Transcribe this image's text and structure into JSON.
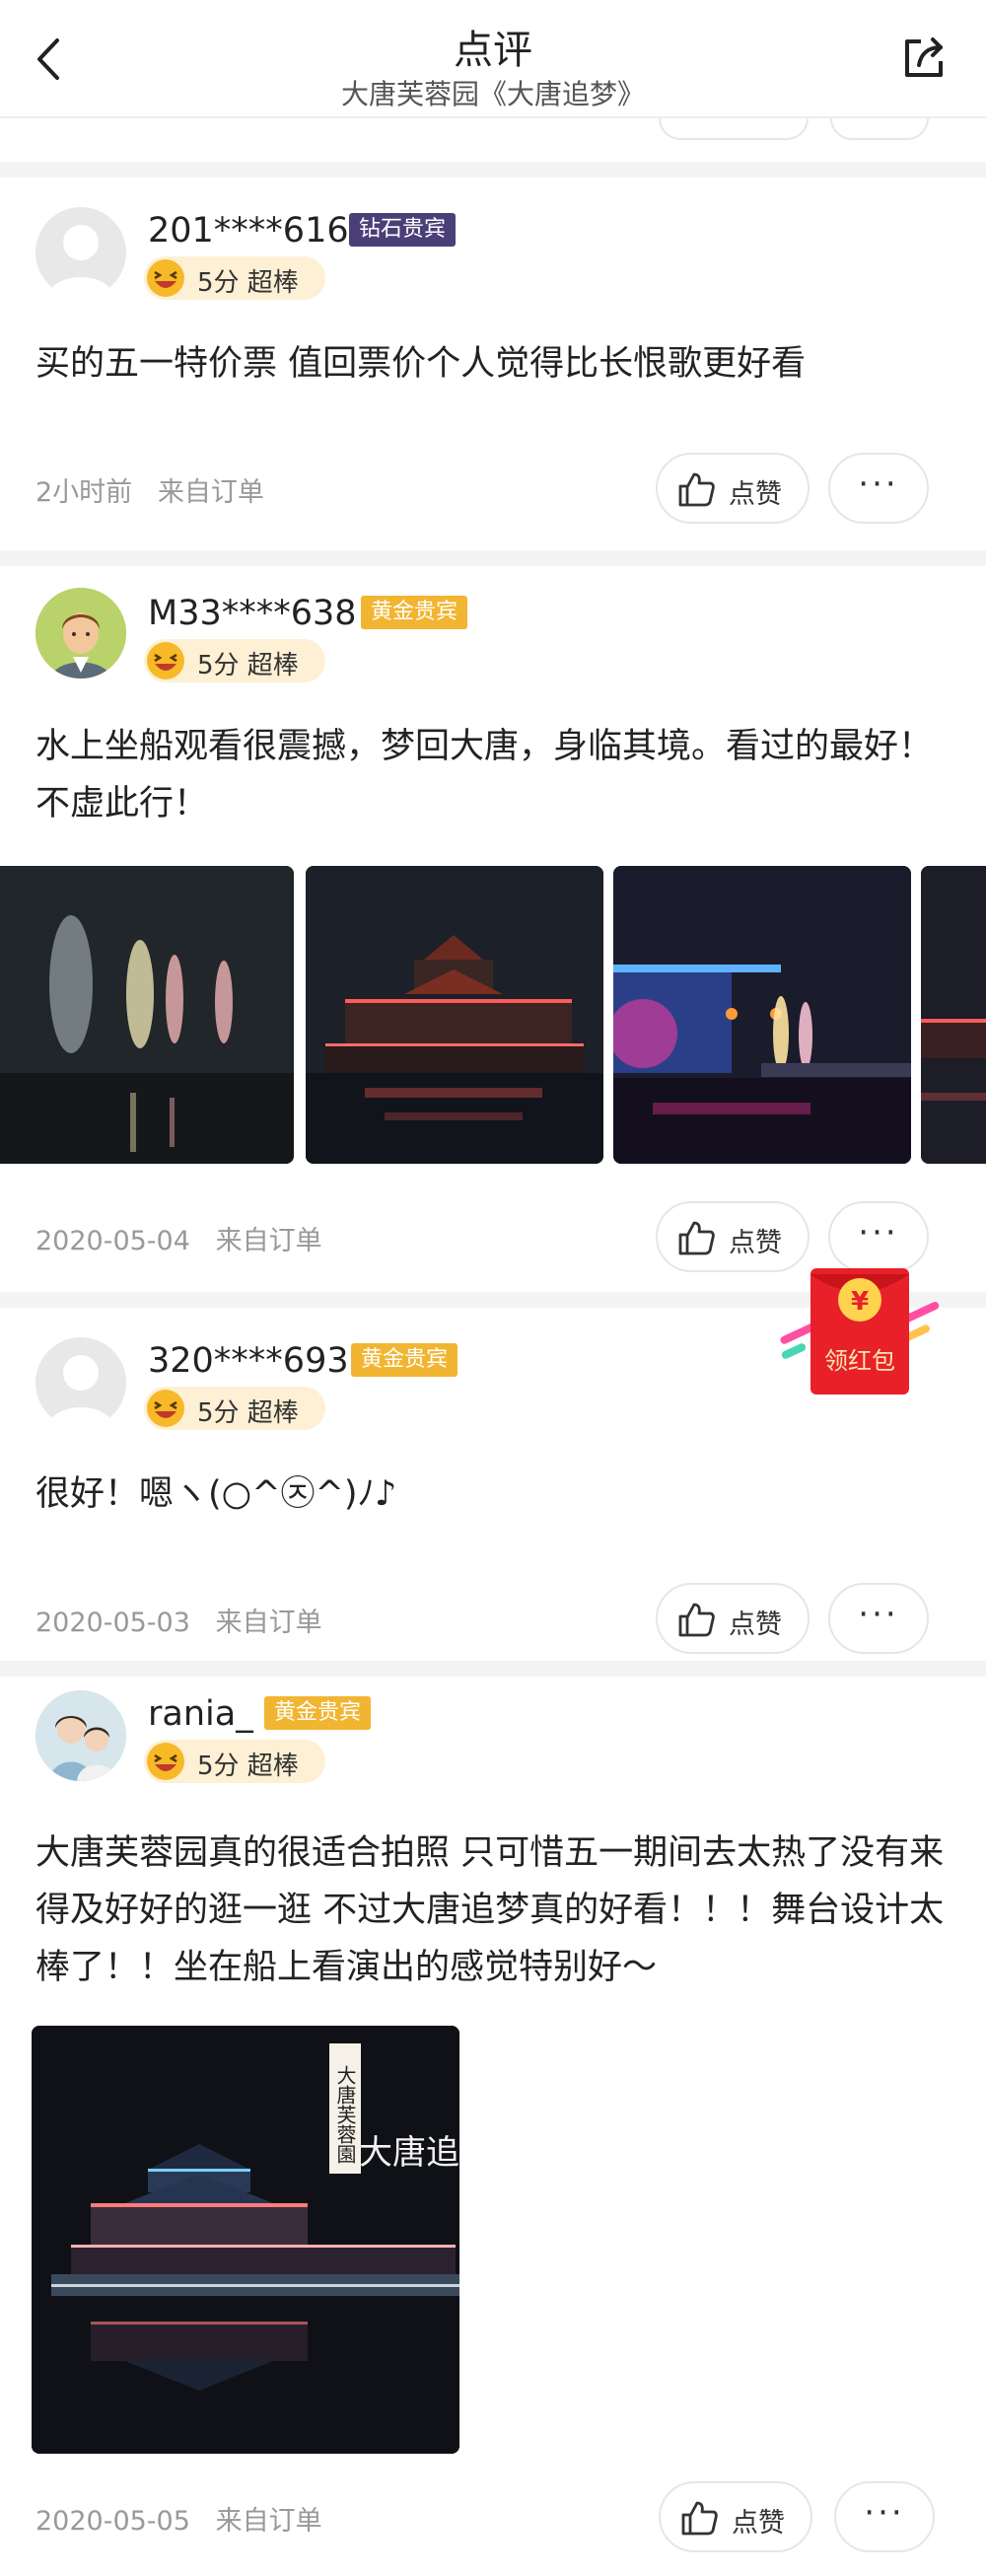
{
  "header": {
    "title": "点评",
    "subtitle": "大唐芙蓉园《大唐追梦》"
  },
  "reviews": [
    {
      "user": "201****616",
      "badge": "钻石贵宾",
      "rating": "5分 超棒",
      "content": "买的五一特价票 值回票价个人觉得比长恨歌更好看",
      "time": "2小时前",
      "source": "来自订单",
      "like_label": "点赞",
      "more_label": "···"
    },
    {
      "user": "M33****638",
      "badge": "黄金贵宾",
      "rating": "5分 超棒",
      "content": "水上坐船观看很震撼，梦回大唐，身临其境。看过的最好！不虚此行！",
      "time": "2020-05-04",
      "source": "来自订单",
      "like_label": "点赞",
      "more_label": "···"
    },
    {
      "user": "320****693",
      "badge": "黄金贵宾",
      "rating": "5分 超棒",
      "content": "很好！嗯ヽ(○^㉨^)ﾉ♪",
      "time": "2020-05-03",
      "source": "来自订单",
      "like_label": "点赞",
      "more_label": "···"
    },
    {
      "user": "rania_",
      "badge": "黄金贵宾",
      "rating": "5分 超棒",
      "content": "大唐芙蓉园真的很适合拍照 只可惜五一期间去太热了没有来得及好好的逛一逛 不过大唐追梦真的好看！！！舞台设计太棒了！！坐在船上看演出的感觉特别好～",
      "photo_text_vertical": "大唐芙蓉園",
      "photo_text_horizontal": "大唐追",
      "time": "2020-05-05",
      "source": "来自订单",
      "like_label": "点赞",
      "more_label": "···"
    }
  ],
  "red_packet": {
    "label": "领红包",
    "symbol": "¥"
  },
  "colors": {
    "diamond_badge": "#4b3f78",
    "gold_badge": "#f2b531",
    "rating_pill": "#fdf0d5",
    "red_packet": "#e8202a",
    "meta_text": "#999999"
  }
}
